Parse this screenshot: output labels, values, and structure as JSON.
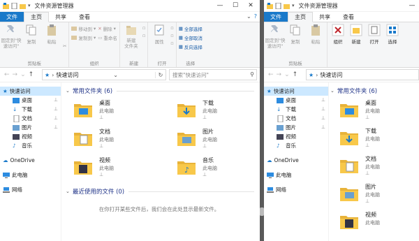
{
  "left": {
    "title": "文件资源管理器",
    "tabs": [
      "文件",
      "主页",
      "共享",
      "查看"
    ],
    "ribbon": {
      "clipboard": {
        "pin": "固定到\"快\n速访问\"",
        "copy": "复制",
        "paste": "粘贴",
        "label": "剪贴板"
      },
      "organize": {
        "move_to": "移动到",
        "copy_to": "复制到",
        "delete": "删除",
        "rename": "重命名",
        "label": "组织"
      },
      "new": {
        "new_folder": "新建\n文件夹",
        "label": "新建"
      },
      "open": {
        "properties": "属性",
        "label": "打开"
      },
      "select": {
        "select_all": "全部选择",
        "select_none": "全部取消",
        "invert": "反向选择",
        "label": "选择"
      }
    },
    "address": "快速访问",
    "search_placeholder": "搜索\"快速访问\"",
    "nav": {
      "quick_access": "快速访问",
      "desktop": "桌面",
      "downloads": "下载",
      "documents": "文档",
      "pictures": "图片",
      "videos": "视频",
      "music": "音乐",
      "onedrive": "OneDrive",
      "this_pc": "此电脑",
      "network": "网络"
    },
    "frequent_header": "常用文件夹 (6)",
    "folders": [
      {
        "name": "桌面",
        "sub": "此电脑"
      },
      {
        "name": "下载",
        "sub": "此电脑"
      },
      {
        "name": "文档",
        "sub": "此电脑"
      },
      {
        "name": "图片",
        "sub": "此电脑"
      },
      {
        "name": "视频",
        "sub": "此电脑"
      },
      {
        "name": "音乐",
        "sub": "此电脑"
      }
    ],
    "recent_header": "最近使用的文件 (0)",
    "recent_empty": "在你打开某些文件后，我们会在此处显示最新文件。"
  },
  "right": {
    "title": "文件资源管理器",
    "tabs": [
      "文件",
      "主页",
      "共享",
      "查看"
    ],
    "ribbon": {
      "pin": "固定到\"快\n速访问\"",
      "copy": "复制",
      "paste": "粘贴",
      "clip_label": "剪贴板",
      "organize": "组织",
      "new": "新建",
      "open": "打开",
      "select": "选择"
    },
    "address": "快速访问",
    "nav": {
      "quick_access": "快速访问",
      "desktop": "桌面",
      "downloads": "下载",
      "documents": "文档",
      "pictures": "图片",
      "videos": "视频",
      "music": "音乐",
      "onedrive": "OneDrive",
      "this_pc": "此电脑",
      "network": "网络"
    },
    "frequent_header": "常用文件夹 (6)",
    "folders": [
      {
        "name": "桌面",
        "sub": "此电脑"
      },
      {
        "name": "下载",
        "sub": "此电脑"
      },
      {
        "name": "文档",
        "sub": "此电脑"
      },
      {
        "name": "图片",
        "sub": "此电脑"
      },
      {
        "name": "视频",
        "sub": "此电脑"
      }
    ]
  },
  "colors": {
    "accent": "#1979ca",
    "folder": "#f8c84a",
    "section": "#1e3287",
    "selected": "#cce8ff"
  }
}
